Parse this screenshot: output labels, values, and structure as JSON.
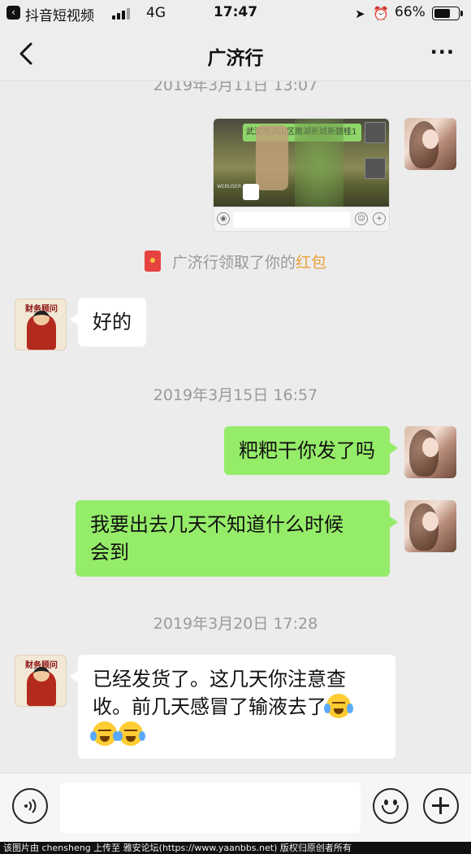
{
  "status_bar": {
    "app_name": "抖音短视频",
    "network": "4G",
    "time": "17:47",
    "battery_percent": "66%",
    "battery_level": 0.66
  },
  "nav": {
    "title": "广济行",
    "more": "···"
  },
  "messages": {
    "ts1": "2019年3月11日 13:07",
    "image_caption": "武汉市洪山区南湖新城新碧桂1",
    "sys_prefix": "广济行领取了你的",
    "sys_link": "红包",
    "m1": "好的",
    "avatar_label": "财务顾问",
    "ts2": "2019年3月15日 16:57",
    "m2": "粑粑干你发了吗",
    "m3_line1": "我要出去几天不知道什么时候",
    "m3_line2": "会到",
    "ts3": "2019年3月20日 17:28",
    "m4_line1": "已经发货了。这几天你注意查",
    "m4_line2": "收。前几天感冒了输液去了"
  },
  "footer": {
    "text": "该图片由 chensheng 上传至 雅安论坛(https://www.yaanbbs.net) 版权归原创者所有"
  },
  "colors": {
    "bubble_me": "#95ec69",
    "bubble_other": "#ffffff",
    "hongbao_link": "#e9a03b",
    "background": "#ececec"
  }
}
